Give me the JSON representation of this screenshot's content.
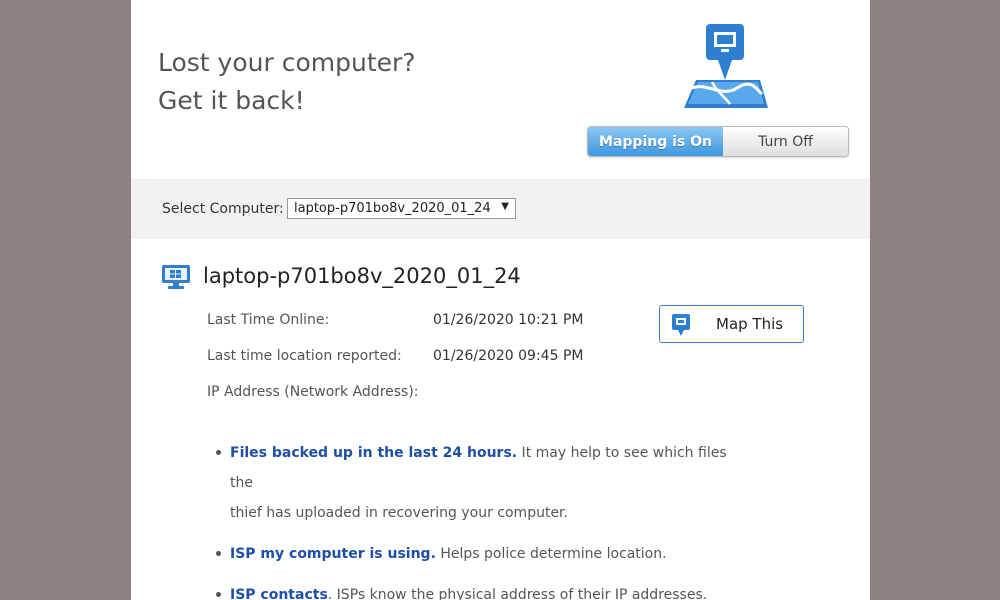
{
  "header": {
    "title_line1": "Lost your computer?",
    "title_line2": "Get it back!"
  },
  "mapping_toggle": {
    "on_label": "Mapping is On",
    "off_label": "Turn Off",
    "state": "on"
  },
  "computer_select": {
    "label": "Select Computer:",
    "selected": "laptop-p701bo8v_2020_01_24",
    "arrow": "▼"
  },
  "computer": {
    "name": "laptop-p701bo8v_2020_01_24",
    "icon": "windows-monitor-icon"
  },
  "details": [
    {
      "label": "Last Time Online:",
      "value": "01/26/2020 10:21 PM"
    },
    {
      "label": "Last time location reported:",
      "value": "01/26/2020 09:45 PM"
    },
    {
      "label": "IP Address (Network Address):",
      "value": ""
    }
  ],
  "map_button": {
    "label": "Map This",
    "icon": "map-pin-icon"
  },
  "bullets": [
    {
      "link": "Files backed up in the last 24 hours.",
      "text1": " It may help to see which files the",
      "text2": "thief has uploaded in recovering your computer."
    },
    {
      "link": "ISP my computer is using.",
      "text1": " Helps police determine location.",
      "text2": ""
    },
    {
      "link": "ISP contacts",
      "text1": ". ISPs know the physical address of their IP addresses.",
      "text2": ""
    }
  ],
  "colors": {
    "accent": "#3d97e0",
    "link": "#1d4fa6",
    "background": "#8b8281"
  }
}
